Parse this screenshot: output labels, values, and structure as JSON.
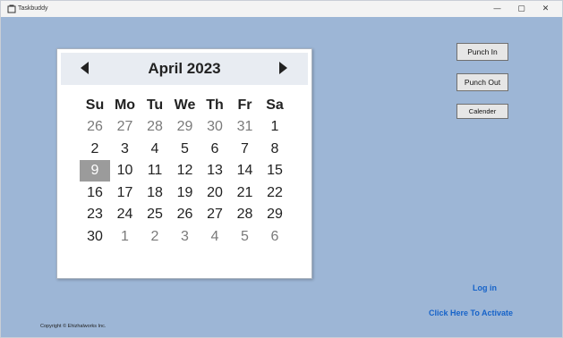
{
  "window": {
    "title": "Taskbuddy",
    "controls": {
      "minimize": "—",
      "maximize": "▢",
      "close": "✕"
    }
  },
  "calendar": {
    "month_label": "April 2023",
    "weekdays": [
      "Su",
      "Mo",
      "Tu",
      "We",
      "Th",
      "Fr",
      "Sa"
    ],
    "weeks": [
      [
        {
          "d": "26",
          "other": true
        },
        {
          "d": "27",
          "other": true
        },
        {
          "d": "28",
          "other": true
        },
        {
          "d": "29",
          "other": true
        },
        {
          "d": "30",
          "other": true
        },
        {
          "d": "31",
          "other": true
        },
        {
          "d": "1",
          "other": false
        }
      ],
      [
        {
          "d": "2",
          "other": false
        },
        {
          "d": "3",
          "other": false
        },
        {
          "d": "4",
          "other": false
        },
        {
          "d": "5",
          "other": false
        },
        {
          "d": "6",
          "other": false
        },
        {
          "d": "7",
          "other": false
        },
        {
          "d": "8",
          "other": false
        }
      ],
      [
        {
          "d": "9",
          "other": false,
          "selected": true
        },
        {
          "d": "10",
          "other": false
        },
        {
          "d": "11",
          "other": false
        },
        {
          "d": "12",
          "other": false
        },
        {
          "d": "13",
          "other": false
        },
        {
          "d": "14",
          "other": false
        },
        {
          "d": "15",
          "other": false
        }
      ],
      [
        {
          "d": "16",
          "other": false
        },
        {
          "d": "17",
          "other": false
        },
        {
          "d": "18",
          "other": false
        },
        {
          "d": "19",
          "other": false
        },
        {
          "d": "20",
          "other": false
        },
        {
          "d": "21",
          "other": false
        },
        {
          "d": "22",
          "other": false
        }
      ],
      [
        {
          "d": "23",
          "other": false
        },
        {
          "d": "24",
          "other": false
        },
        {
          "d": "25",
          "other": false
        },
        {
          "d": "26",
          "other": false
        },
        {
          "d": "27",
          "other": false
        },
        {
          "d": "28",
          "other": false
        },
        {
          "d": "29",
          "other": false
        }
      ],
      [
        {
          "d": "30",
          "other": false
        },
        {
          "d": "1",
          "other": true
        },
        {
          "d": "2",
          "other": true
        },
        {
          "d": "3",
          "other": true
        },
        {
          "d": "4",
          "other": true
        },
        {
          "d": "5",
          "other": true
        },
        {
          "d": "6",
          "other": true
        }
      ]
    ]
  },
  "buttons": {
    "punch_in": "Punch In",
    "punch_out": "Punch Out",
    "calender": "Calender"
  },
  "links": {
    "login": "Log in",
    "activate": "Click Here To Activate"
  },
  "footer": {
    "copyright": "Copyright © Ehizhalworks Inc."
  },
  "colors": {
    "background": "#9db6d6",
    "link": "#1663c9",
    "selected_day": "#9b9b9b"
  }
}
